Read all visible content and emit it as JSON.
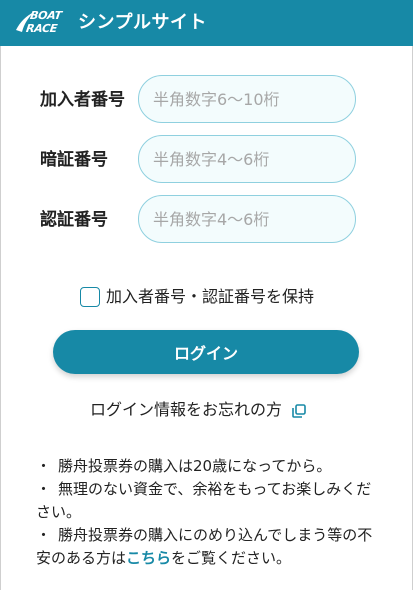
{
  "header": {
    "logo_line1": "BOAT",
    "logo_line2": "RACE",
    "title": "シンプルサイト"
  },
  "form": {
    "member_label": "加入者番号",
    "member_placeholder": "半角数字6〜10桁",
    "pin_label": "暗証番号",
    "pin_placeholder": "半角数字4〜6桁",
    "auth_label": "認証番号",
    "auth_placeholder": "半角数字4〜6桁",
    "keep_label": "加入者番号・認証番号を保持",
    "keep_checked": false,
    "login_button": "ログイン",
    "forgot_link": "ログイン情報をお忘れの方"
  },
  "notes": {
    "bullet": "・",
    "note1": "勝舟投票券の購入は20歳になってから。",
    "note2": "無理のない資金で、余裕をもってお楽しみください。",
    "note3_before": "勝舟投票券の購入にのめり込んでしまう等の不安のある方は",
    "note3_link": "こちら",
    "note3_after": "をご覧ください。"
  },
  "colors": {
    "brand": "#1789a6",
    "input_border": "#8fd0df",
    "input_bg": "#f3fcfd"
  },
  "icons": {
    "logo": "boatrace-logo",
    "external": "external-link-icon"
  }
}
